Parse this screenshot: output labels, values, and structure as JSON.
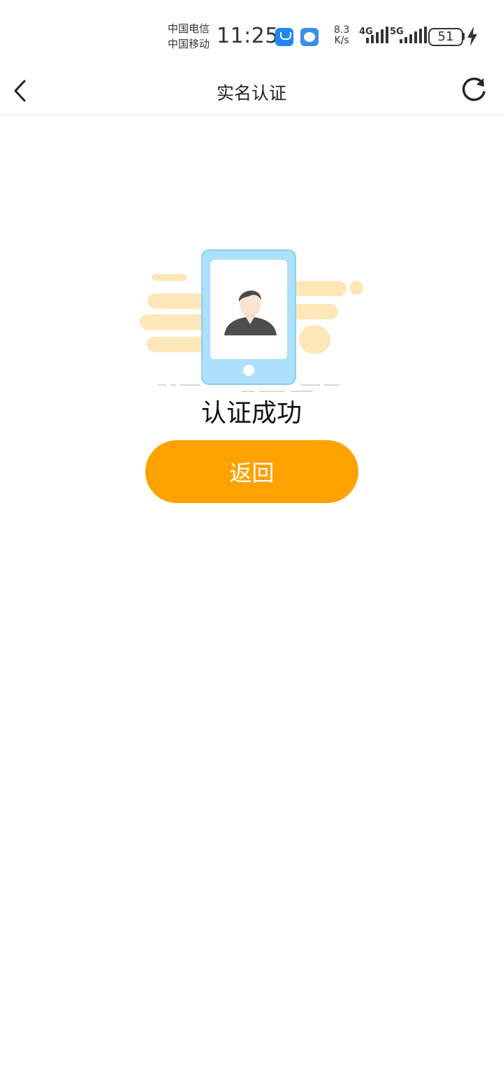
{
  "status_bar": {
    "carrier_1": "中国电信",
    "carrier_2": "中国移动",
    "time": "11:25",
    "net_speed_value": "8.3",
    "net_speed_unit": "K/s",
    "signal_1_label": "4G",
    "signal_2_label": "5G",
    "battery_level": "51"
  },
  "nav": {
    "title": "实名认证",
    "back_icon": "chevron-left-icon",
    "refresh_icon": "refresh-icon"
  },
  "content": {
    "result_text": "认证成功",
    "return_button_label": "返回"
  },
  "colors": {
    "accent": "#ffa200",
    "phone_body": "#aee0fb",
    "decor": "#fde7b9"
  }
}
